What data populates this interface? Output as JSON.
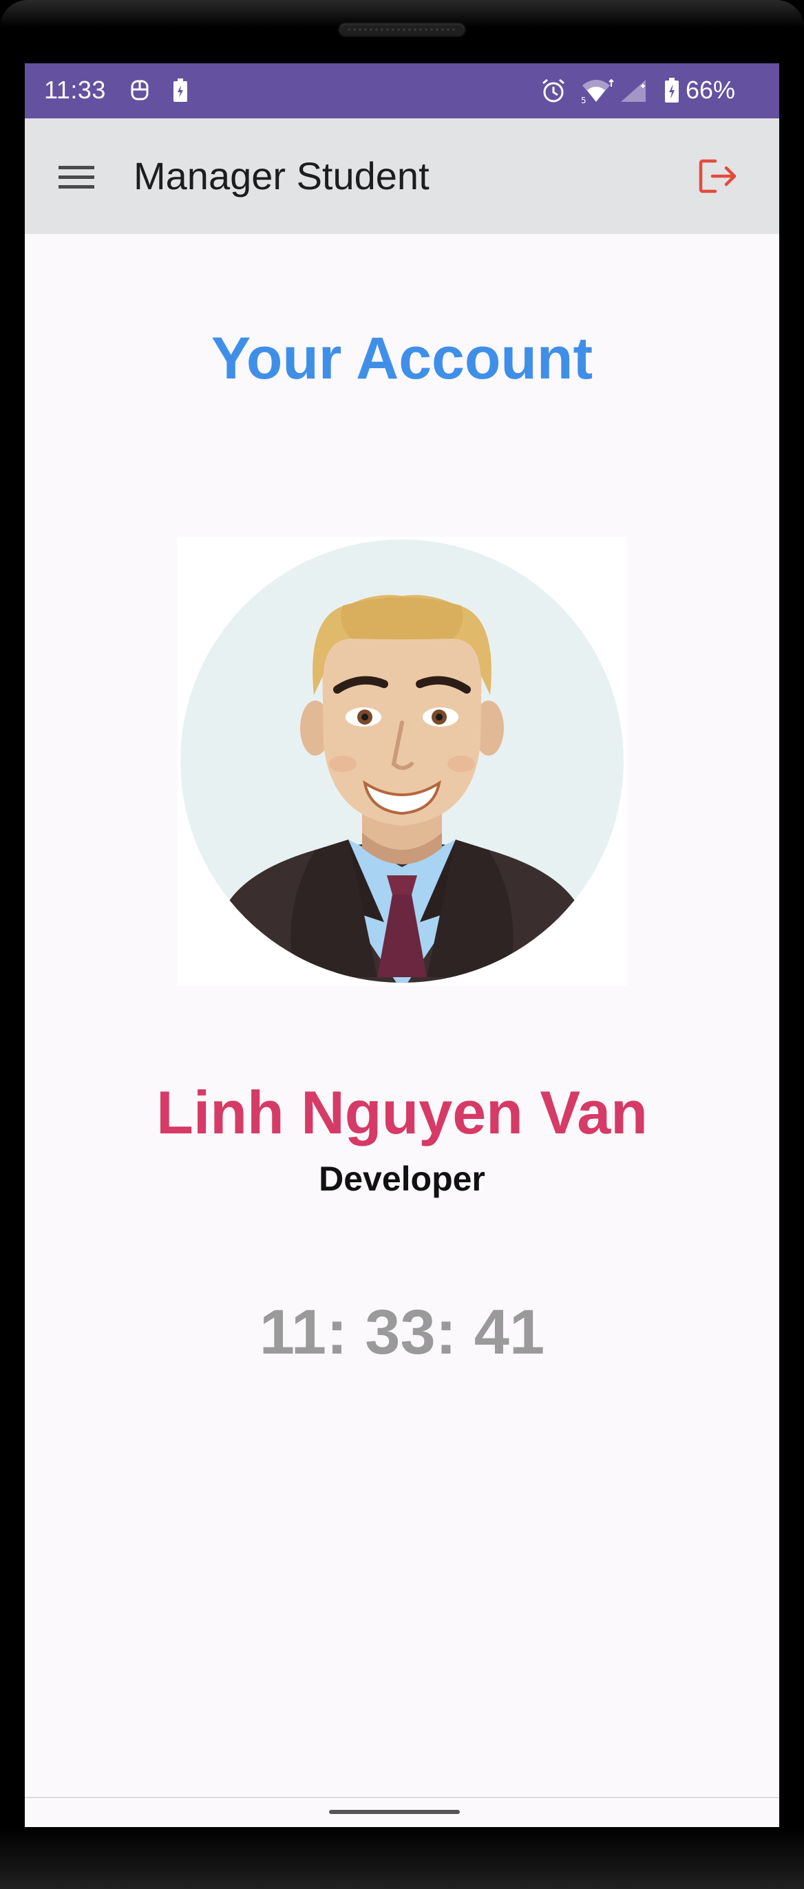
{
  "status_bar": {
    "time": "11:33",
    "battery_percent": "66%",
    "icons": [
      "notification-app-icon",
      "battery-saver-icon",
      "alarm-icon",
      "wifi-icon",
      "cell-signal-icon",
      "battery-charging-icon"
    ],
    "color": "#6451a0"
  },
  "app_bar": {
    "title": "Manager Student",
    "menu_icon": "hamburger-menu-icon",
    "logout_icon": "logout-icon",
    "logout_color": "#e44b3c"
  },
  "account": {
    "heading": "Your Account",
    "avatar": "male-avatar-illustration",
    "name": "Linh Nguyen Van",
    "role": "Developer",
    "clock": "11: 33: 41"
  },
  "colors": {
    "heading": "#3f8fe8",
    "name": "#d63a66",
    "clock": "#9a9a9a",
    "background": "#fbf9fc"
  }
}
